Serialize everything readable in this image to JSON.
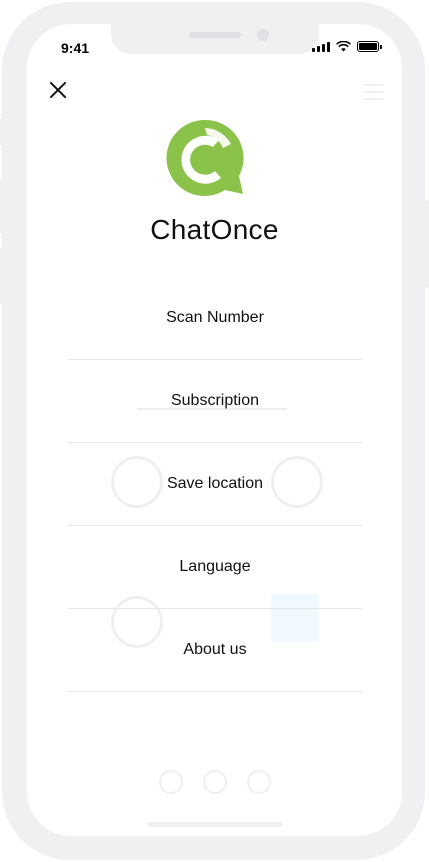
{
  "status_bar": {
    "time": "9:41"
  },
  "app": {
    "name": "ChatOnce",
    "accent_color": "#8bc34a"
  },
  "menu": {
    "items": [
      {
        "label": "Scan Number"
      },
      {
        "label": "Subscription"
      },
      {
        "label": "Save location"
      },
      {
        "label": "Language"
      },
      {
        "label": "About us"
      }
    ]
  },
  "icons": {
    "close": "close-icon",
    "logo": "chatonce-logo",
    "background_menu": "hamburger-icon"
  }
}
